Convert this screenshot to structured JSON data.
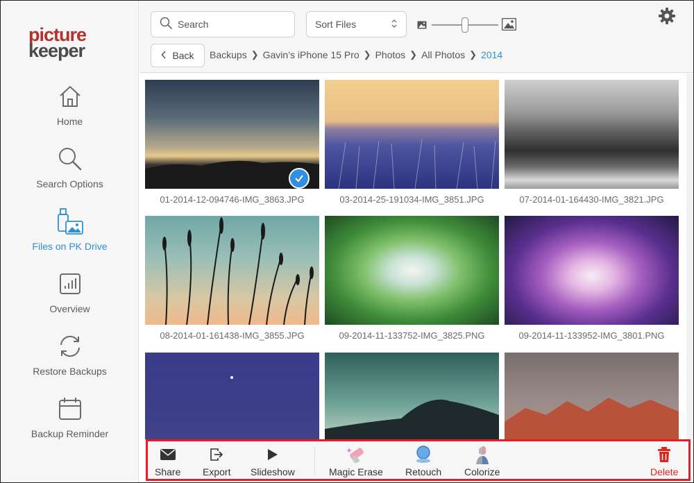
{
  "app": {
    "logo_line1": "picture",
    "logo_line2": "keeper"
  },
  "sidebar": {
    "items": [
      {
        "label": "Home",
        "icon": "home-icon"
      },
      {
        "label": "Search Options",
        "icon": "search-icon"
      },
      {
        "label": "Files on PK Drive",
        "icon": "usb-drive-photo-icon",
        "active": true
      },
      {
        "label": "Overview",
        "icon": "chart-icon"
      },
      {
        "label": "Restore Backups",
        "icon": "sync-icon"
      },
      {
        "label": "Backup Reminder",
        "icon": "calendar-icon"
      }
    ]
  },
  "header": {
    "search_placeholder": "Search",
    "sort_label": "Sort Files",
    "back_label": "Back",
    "breadcrumb": [
      "Backups",
      "Gavin’s iPhone 15 Pro",
      "Photos",
      "All Photos",
      "2014"
    ],
    "thumbnail_size_level": 0.5
  },
  "photos": [
    {
      "name": "01-2014-12-094746-IMG_3863.JPG",
      "selected": true
    },
    {
      "name": "03-2014-25-191034-IMG_3851.JPG"
    },
    {
      "name": "07-2014-01-164430-IMG_3821.JPG"
    },
    {
      "name": "08-2014-01-161438-IMG_3855.JPG"
    },
    {
      "name": "09-2014-11-133752-IMG_3825.PNG"
    },
    {
      "name": "09-2014-11-133952-IMG_3801.PNG"
    },
    {
      "name": ""
    },
    {
      "name": ""
    },
    {
      "name": ""
    }
  ],
  "toolbar": {
    "share": "Share",
    "export": "Export",
    "slideshow": "Slideshow",
    "magic_erase": "Magic Erase",
    "retouch": "Retouch",
    "colorize": "Colorize",
    "delete": "Delete"
  },
  "colors": {
    "accent": "#2d8fd6",
    "highlight_border": "#e81c23",
    "delete": "#d9281f",
    "logo_red": "#b3332a"
  }
}
